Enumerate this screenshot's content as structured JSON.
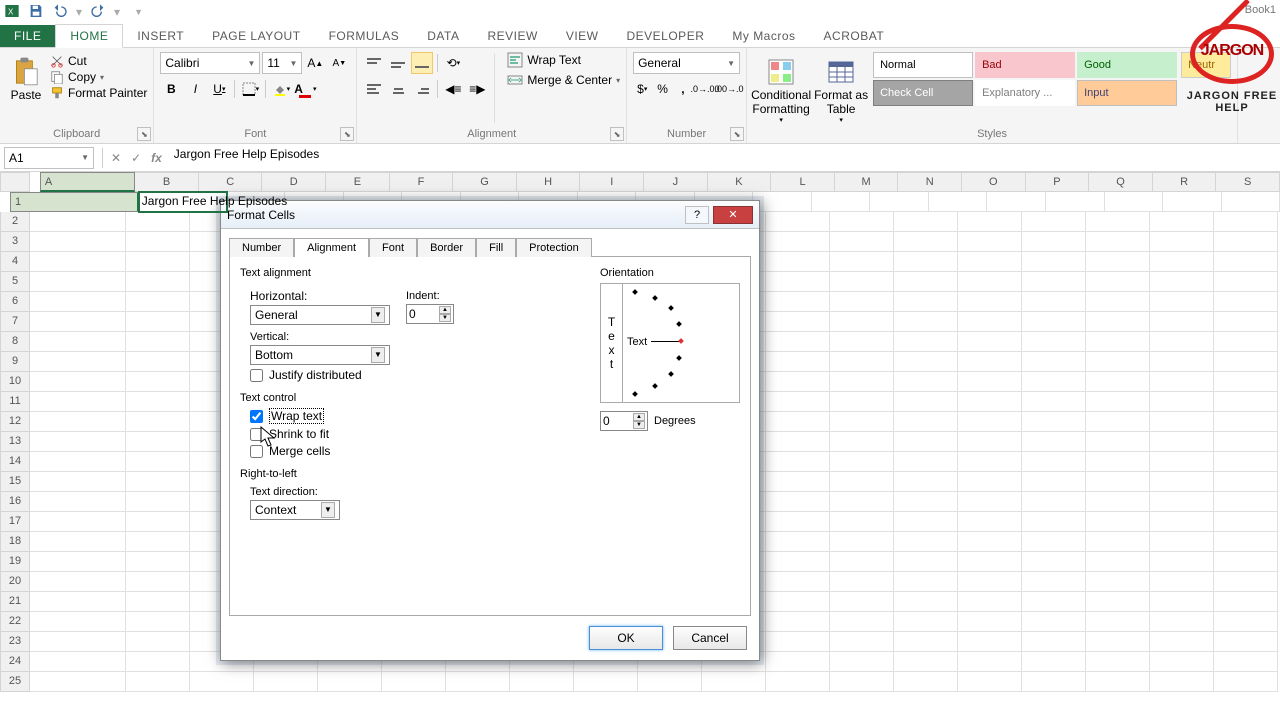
{
  "workbook_title": "Book1",
  "qat": {
    "save": "save",
    "undo": "undo",
    "redo": "redo"
  },
  "tabs": [
    "FILE",
    "HOME",
    "INSERT",
    "PAGE LAYOUT",
    "FORMULAS",
    "DATA",
    "REVIEW",
    "VIEW",
    "DEVELOPER",
    "My Macros",
    "ACROBAT"
  ],
  "active_tab": "HOME",
  "ribbon": {
    "clipboard": {
      "title": "Clipboard",
      "paste": "Paste",
      "cut": "Cut",
      "copy": "Copy",
      "painter": "Format Painter"
    },
    "font": {
      "title": "Font",
      "name": "Calibri",
      "size": "11"
    },
    "alignment": {
      "title": "Alignment",
      "wrap": "Wrap Text",
      "merge": "Merge & Center"
    },
    "number": {
      "title": "Number",
      "format": "General"
    },
    "cond": "Conditional Formatting",
    "table": "Format as Table",
    "styles": {
      "title": "Styles",
      "cells": [
        {
          "label": "Normal",
          "bg": "#ffffff",
          "fg": "#000",
          "border": "#c0c0c0"
        },
        {
          "label": "Bad",
          "bg": "#f9c6ce",
          "fg": "#9c0006",
          "border": "#f9c6ce"
        },
        {
          "label": "Good",
          "bg": "#c6efce",
          "fg": "#006100",
          "border": "#c6efce"
        },
        {
          "label": "Check Cell",
          "bg": "#a5a5a5",
          "fg": "#ffffff",
          "border": "#7f7f7f"
        },
        {
          "label": "Explanatory ...",
          "bg": "#ffffff",
          "fg": "#7f7f7f",
          "border": "#ffffff"
        },
        {
          "label": "Input",
          "bg": "#ffcc99",
          "fg": "#3f3f76",
          "border": "#bfbfbf"
        }
      ],
      "neutral": "Neutr"
    }
  },
  "name_box": "A1",
  "formula": "Jargon Free Help Episodes",
  "columns": [
    "A",
    "B",
    "C",
    "D",
    "E",
    "F",
    "G",
    "H",
    "I",
    "J",
    "K",
    "L",
    "M",
    "N",
    "O",
    "P",
    "Q",
    "R",
    "S"
  ],
  "row_count": 25,
  "active_cell": {
    "row": 1,
    "col": "A",
    "value": "Jargon Free Help Episodes"
  },
  "dialog": {
    "title": "Format Cells",
    "tabs": [
      "Number",
      "Alignment",
      "Font",
      "Border",
      "Fill",
      "Protection"
    ],
    "active_tab": "Alignment",
    "text_alignment": "Text alignment",
    "horizontal_label": "Horizontal:",
    "horizontal": "General",
    "indent_label": "Indent:",
    "indent": "0",
    "vertical_label": "Vertical:",
    "vertical": "Bottom",
    "justify": "Justify distributed",
    "text_control": "Text control",
    "wrap": "Wrap text",
    "shrink": "Shrink to fit",
    "merge": "Merge cells",
    "rtl": "Right-to-left",
    "dir_label": "Text direction:",
    "dir": "Context",
    "orientation": "Orientation",
    "degrees_label": "Degrees",
    "degrees": "0",
    "text_word": "Text",
    "ok": "OK",
    "cancel": "Cancel"
  },
  "watermark": {
    "top": "JARGON",
    "bottom": "JARGON FREE HELP"
  }
}
